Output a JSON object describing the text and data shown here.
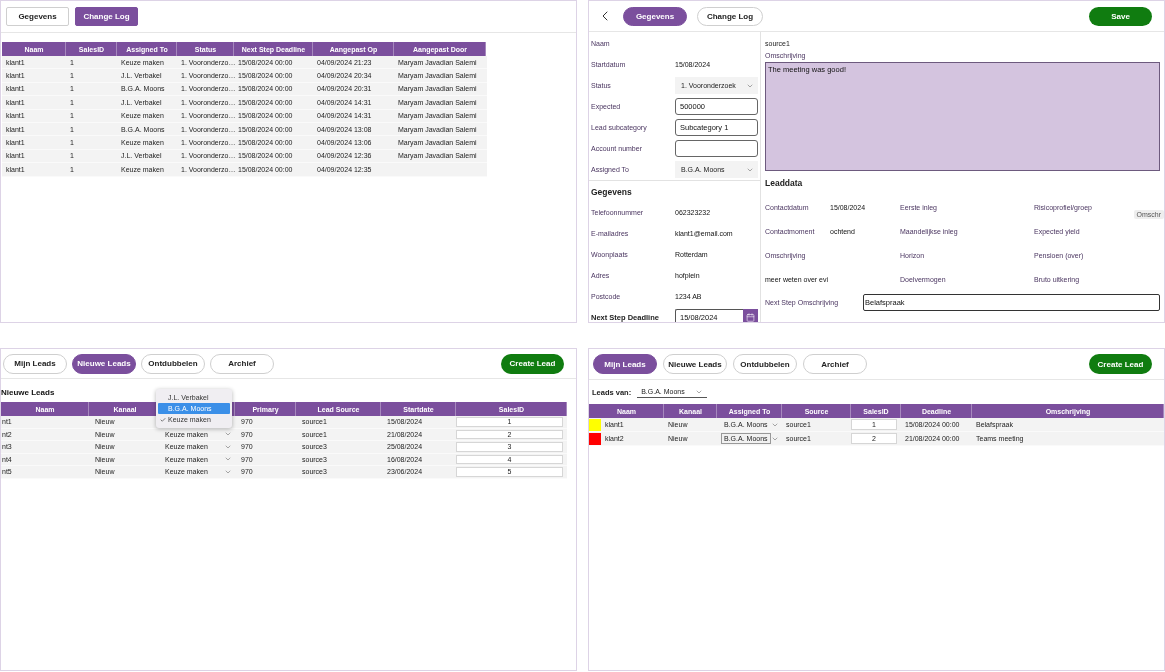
{
  "change_log_screen": {
    "tabs": [
      {
        "label": "Gegevens",
        "selected": false
      },
      {
        "label": "Change Log",
        "selected": true
      }
    ],
    "table": {
      "columns": [
        "Naam",
        "SalesID",
        "Assigned To",
        "Status",
        "Next Step Deadline",
        "Aangepast Op",
        "Aangepast Door"
      ],
      "rows": [
        [
          "klant1",
          "1",
          "Keuze maken",
          "1. Vooronderzo…",
          "15/08/2024 00:00",
          "04/09/2024 21:23",
          "Maryam Javadian Salemi"
        ],
        [
          "klant1",
          "1",
          "J.L. Verbakel",
          "1. Vooronderzo…",
          "15/08/2024 00:00",
          "04/09/2024 20:34",
          "Maryam Javadian Salemi"
        ],
        [
          "klant1",
          "1",
          "B.G.A. Moons",
          "1. Vooronderzo…",
          "15/08/2024 00:00",
          "04/09/2024 20:31",
          "Maryam Javadian Salemi"
        ],
        [
          "klant1",
          "1",
          "J.L. Verbakel",
          "1. Vooronderzo…",
          "15/08/2024 00:00",
          "04/09/2024 14:31",
          "Maryam Javadian Salemi"
        ],
        [
          "klant1",
          "1",
          "Keuze maken",
          "1. Vooronderzo…",
          "15/08/2024 00:00",
          "04/09/2024 14:31",
          "Maryam Javadian Salemi"
        ],
        [
          "klant1",
          "1",
          "B.G.A. Moons",
          "1. Vooronderzo…",
          "15/08/2024 00:00",
          "04/09/2024 13:08",
          "Maryam Javadian Salemi"
        ],
        [
          "klant1",
          "1",
          "Keuze maken",
          "1. Vooronderzo…",
          "15/08/2024 00:00",
          "04/09/2024 13:06",
          "Maryam Javadian Salemi"
        ],
        [
          "klant1",
          "1",
          "J.L. Verbakel",
          "1. Vooronderzo…",
          "15/08/2024 00:00",
          "04/09/2024 12:36",
          "Maryam Javadian Salemi"
        ],
        [
          "klant1",
          "1",
          "Keuze maken",
          "1. Vooronderzo…",
          "15/08/2024 00:00",
          "04/09/2024 12:35"
        ]
      ]
    }
  },
  "details_screen": {
    "tabs": [
      {
        "label": "Gegevens",
        "selected": true
      },
      {
        "label": "Change Log",
        "selected": false
      }
    ],
    "save_button": "Save",
    "form_fields": [
      {
        "label": "Naam",
        "kind": "text"
      },
      {
        "label": "Startdatum",
        "kind": "text",
        "value": "15/08/2024"
      },
      {
        "label": "Status",
        "kind": "select",
        "value": "1. Vooronderzoek"
      },
      {
        "label": "Expected",
        "kind": "input",
        "value": "500000"
      },
      {
        "label": "Lead subcategory",
        "kind": "input",
        "value": "Subcategory 1"
      },
      {
        "label": "Account number",
        "kind": "input"
      },
      {
        "label": "Assigned To",
        "kind": "select",
        "value": "B.G.A. Moons"
      }
    ],
    "contact_section": {
      "title": "Gegevens",
      "fields": [
        {
          "label": "Telefoonnummer",
          "kind": "text",
          "value": "062323232"
        },
        {
          "label": "E-mailadres",
          "kind": "text",
          "value": "klant1@email.com"
        },
        {
          "label": "Woonplaats",
          "kind": "text",
          "value": "Rotterdam"
        },
        {
          "label": "Adres",
          "kind": "text",
          "value": "hofplein"
        },
        {
          "label": "Postcode",
          "kind": "text",
          "value": "1234 AB"
        }
      ]
    },
    "deadline": {
      "label": "Next Step Deadline",
      "value": "15/08/2024"
    },
    "source": "source1",
    "description": {
      "label": "Omschrijving",
      "value": "The meeting was good!"
    },
    "tooltip": "Omschr",
    "leaddata": {
      "title": "Leaddata",
      "cells": [
        {
          "kind": "field",
          "label": "Contactdatum",
          "value": "15/08/2024"
        },
        {
          "kind": "field",
          "label": "Eerste inleg"
        },
        {
          "kind": "field",
          "label": "Risicoprofiel/groep"
        },
        {
          "kind": "field",
          "label": "Contactmoment",
          "value": "ochtend"
        },
        {
          "kind": "field",
          "label": "Maandelijkse inleg"
        },
        {
          "kind": "field",
          "label": "Expected yield"
        },
        {
          "kind": "field",
          "label": "Omschrijving"
        },
        {
          "kind": "field",
          "label": "Horizon"
        },
        {
          "kind": "field",
          "label": "Pensioen (over)"
        },
        {
          "kind": "text",
          "text": "meer weten over evi"
        },
        {
          "kind": "field",
          "label": "Doelvermogen"
        },
        {
          "kind": "field",
          "label": "Bruto uitkering"
        }
      ]
    },
    "next_step": {
      "label": "Next Step Omschrijving",
      "value": "Belafspraak"
    }
  },
  "new_leads_screen": {
    "tabs": [
      {
        "label": "Mijn Leads",
        "selected": false
      },
      {
        "label": "Nieuwe Leads",
        "selected": true
      },
      {
        "label": "Ontdubbelen",
        "selected": false
      },
      {
        "label": "Archief",
        "selected": false
      }
    ],
    "create_button": "Create Lead",
    "title": "Nieuwe Leads",
    "table": {
      "columns": [
        "Naam",
        "Kanaal",
        null,
        "Primary",
        "Lead Source",
        "Startdate",
        "SalesID"
      ],
      "rows": [
        {
          "naam": "nt1",
          "kanaal": "Nieuw",
          "primary": "970",
          "source": "source1",
          "startdate": "15/08/2024",
          "sales_id": "1"
        },
        {
          "naam": "nt2",
          "kanaal": "Nieuw",
          "assigned": "Keuze maken",
          "primary": "970",
          "source": "source1",
          "startdate": "21/08/2024",
          "sales_id": "2"
        },
        {
          "naam": "nt3",
          "kanaal": "Nieuw",
          "assigned": "Keuze maken",
          "primary": "970",
          "source": "source3",
          "startdate": "25/08/2024",
          "sales_id": "3"
        },
        {
          "naam": "nt4",
          "kanaal": "Nieuw",
          "assigned": "Keuze maken",
          "primary": "970",
          "source": "source3",
          "startdate": "16/08/2024",
          "sales_id": "4"
        },
        {
          "naam": "nt5",
          "kanaal": "Nieuw",
          "assigned": "Keuze maken",
          "primary": "970",
          "source": "source3",
          "startdate": "23/06/2024",
          "sales_id": "5"
        }
      ]
    },
    "assignee_menu": {
      "options": [
        {
          "label": "J.L. Verbakel",
          "highlighted": false,
          "checked": false
        },
        {
          "label": "B.G.A. Moons",
          "highlighted": true,
          "checked": false
        },
        {
          "label": "Keuze maken",
          "highlighted": false,
          "checked": true
        }
      ]
    }
  },
  "my_leads_screen": {
    "tabs": [
      {
        "label": "Mijn Leads",
        "selected": true
      },
      {
        "label": "Nieuwe Leads",
        "selected": false
      },
      {
        "label": "Ontdubbelen",
        "selected": false
      },
      {
        "label": "Archief",
        "selected": false
      }
    ],
    "create_button": "Create Lead",
    "filter": {
      "label": "Leads van:",
      "value": "B.G.A. Moons"
    },
    "table": {
      "columns": [
        "Naam",
        "Kanaal",
        "Assigned To",
        "Source",
        "SalesID",
        "Deadline",
        "Omschrijving"
      ],
      "rows": [
        {
          "color": "#ffff00",
          "naam": "klant1",
          "kanaal": "Nieuw",
          "assigned": "B.G.A. Moons",
          "focused": false,
          "source": "source1",
          "sales_id": "1",
          "deadline": "15/08/2024 00:00",
          "omschrijving": "Belafspraak"
        },
        {
          "color": "#ff0000",
          "naam": "klant2",
          "kanaal": "Nieuw",
          "assigned": "B.G.A. Moons",
          "focused": true,
          "source": "source1",
          "sales_id": "2",
          "deadline": "21/08/2024 00:00",
          "omschrijving": "Teams meeting"
        }
      ]
    }
  }
}
